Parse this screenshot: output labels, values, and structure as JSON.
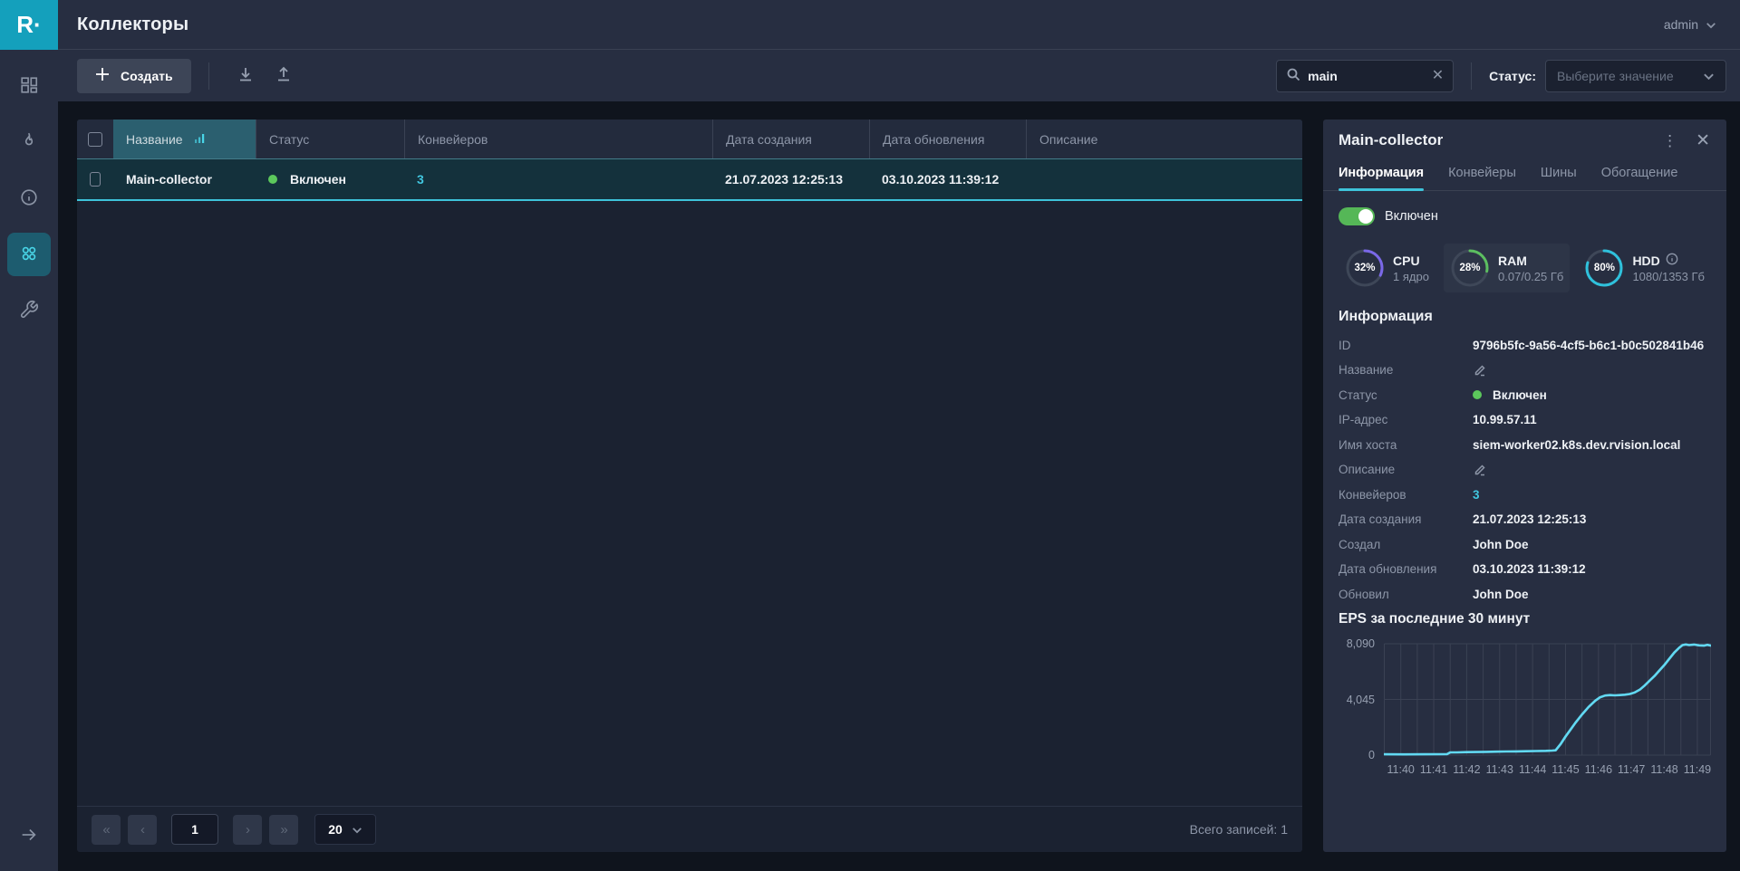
{
  "app": {
    "logo_text": "R·",
    "user": "admin"
  },
  "header": {
    "title": "Коллекторы"
  },
  "toolbar": {
    "create_label": "Создать",
    "search_value": "main",
    "status_label": "Статус:",
    "status_placeholder": "Выберите значение"
  },
  "table": {
    "columns": {
      "name": "Название",
      "status": "Статус",
      "pipelines": "Конвейеров",
      "created": "Дата создания",
      "updated": "Дата обновления",
      "description": "Описание"
    },
    "row": {
      "name": "Main-collector",
      "status": "Включен",
      "pipelines": "3",
      "created": "21.07.2023 12:25:13",
      "updated": "03.10.2023 11:39:12",
      "description": ""
    },
    "pagination": {
      "page": "1",
      "page_size": "20",
      "total_label": "Всего записей: 1"
    }
  },
  "panel": {
    "title": "Main-collector",
    "tabs": {
      "t0": "Информация",
      "t1": "Конвейеры",
      "t2": "Шины",
      "t3": "Обогащение"
    },
    "toggle_label": "Включен",
    "stats": {
      "cpu": {
        "pct": "32%",
        "value": 32,
        "label": "CPU",
        "sub": "1 ядро",
        "color": "#7a68e8"
      },
      "ram": {
        "pct": "28%",
        "value": 28,
        "label": "RAM",
        "sub": "0.07/0.25 Гб",
        "color": "#5cbf60"
      },
      "hdd": {
        "pct": "80%",
        "value": 80,
        "label": "HDD",
        "sub": "1080/1353 Гб",
        "color": "#2fc1dc"
      }
    },
    "info_heading": "Информация",
    "fields": {
      "id": {
        "label": "ID",
        "value": "9796b5fc-9a56-4cf5-b6c1-b0c502841b46"
      },
      "name": {
        "label": "Название"
      },
      "status": {
        "label": "Статус",
        "value": "Включен"
      },
      "ip": {
        "label": "IP-адрес",
        "value": "10.99.57.11"
      },
      "host": {
        "label": "Имя хоста",
        "value": "siem-worker02.k8s.dev.rvision.local"
      },
      "description": {
        "label": "Описание"
      },
      "pipelines": {
        "label": "Конвейеров",
        "value": "3"
      },
      "created": {
        "label": "Дата создания",
        "value": "21.07.2023 12:25:13"
      },
      "created_by": {
        "label": "Создал",
        "value": "John Doe"
      },
      "updated": {
        "label": "Дата обновления",
        "value": "03.10.2023 11:39:12"
      },
      "updated_by": {
        "label": "Обновил",
        "value": "John Doe"
      }
    },
    "chart_heading": "EPS за последние 30 минут"
  },
  "status_colors": {
    "enabled_dot": "#5cc85c",
    "accent": "#3ec3da"
  },
  "chart_data": {
    "type": "line",
    "title": "EPS за последние 30 минут",
    "line_color": "#62d9f2",
    "grid_color": "#3a4153",
    "ylim": [
      0,
      8090
    ],
    "y_ticks": [
      "8,090",
      "4,045",
      "0"
    ],
    "y_tick_values": [
      8090,
      4045,
      0
    ],
    "x_ticks": [
      "11:40",
      "11:41",
      "11:42",
      "11:43",
      "11:44",
      "11:45",
      "11:46",
      "11:47",
      "11:48",
      "11:49"
    ],
    "x_range_minutes": [
      0,
      9.9
    ],
    "first_tick_offset_minutes": 0.5,
    "grid_step_minutes": 0.5,
    "legend": "none",
    "points": [
      [
        0,
        60
      ],
      [
        0.6,
        55
      ],
      [
        1.2,
        60
      ],
      [
        1.9,
        65
      ],
      [
        2.0,
        195
      ],
      [
        2.2,
        200
      ],
      [
        2.5,
        215
      ],
      [
        2.8,
        225
      ],
      [
        3.1,
        235
      ],
      [
        3.4,
        250
      ],
      [
        3.7,
        260
      ],
      [
        4.0,
        270
      ],
      [
        4.3,
        285
      ],
      [
        4.6,
        295
      ],
      [
        4.9,
        310
      ],
      [
        5.1,
        330
      ],
      [
        5.2,
        350
      ],
      [
        5.35,
        800
      ],
      [
        5.5,
        1350
      ],
      [
        5.65,
        1850
      ],
      [
        5.8,
        2350
      ],
      [
        6.0,
        2950
      ],
      [
        6.2,
        3500
      ],
      [
        6.4,
        3950
      ],
      [
        6.55,
        4200
      ],
      [
        6.7,
        4330
      ],
      [
        6.85,
        4360
      ],
      [
        7.0,
        4340
      ],
      [
        7.15,
        4360
      ],
      [
        7.3,
        4390
      ],
      [
        7.45,
        4440
      ],
      [
        7.6,
        4550
      ],
      [
        7.75,
        4750
      ],
      [
        7.9,
        5050
      ],
      [
        8.05,
        5400
      ],
      [
        8.2,
        5750
      ],
      [
        8.35,
        6150
      ],
      [
        8.5,
        6550
      ],
      [
        8.65,
        7000
      ],
      [
        8.8,
        7450
      ],
      [
        8.95,
        7800
      ],
      [
        9.05,
        7990
      ],
      [
        9.15,
        8040
      ],
      [
        9.25,
        7990
      ],
      [
        9.4,
        8030
      ],
      [
        9.55,
        7970
      ],
      [
        9.7,
        7950
      ],
      [
        9.8,
        8010
      ],
      [
        9.9,
        7960
      ]
    ]
  }
}
